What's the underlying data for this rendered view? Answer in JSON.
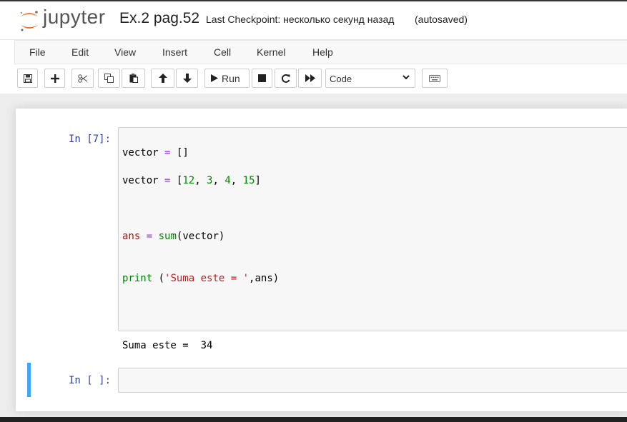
{
  "header": {
    "logo_text": "jupyter",
    "notebook_title": "Ex.2 pag.52",
    "checkpoint": "Last Checkpoint: несколько секунд назад",
    "autosave": "(autosaved)"
  },
  "menu": {
    "items": [
      "File",
      "Edit",
      "View",
      "Insert",
      "Cell",
      "Kernel",
      "Help"
    ]
  },
  "toolbar": {
    "run_label": "Run",
    "cell_type": "Code",
    "icons": [
      "save-icon",
      "plus-icon",
      "cut-icon",
      "copy-icon",
      "paste-icon",
      "arrow-up-icon",
      "arrow-down-icon",
      "run-icon",
      "stop-icon",
      "restart-icon",
      "fast-forward-icon",
      "keyboard-icon"
    ]
  },
  "cells": [
    {
      "prompt": "In [7]:",
      "lines": [
        [
          "vector",
          " ",
          "=",
          " ",
          "[]"
        ],
        [
          "vector",
          " ",
          "=",
          " ",
          "[",
          "12",
          ", ",
          "3",
          ", ",
          "4",
          ", ",
          "15",
          "]"
        ],
        [
          "ans",
          " ",
          "=",
          " ",
          "sum",
          "(vector)"
        ],
        [
          "print",
          " (",
          "'Suma este = '",
          ",ans)"
        ]
      ],
      "output": "Suma este =  34"
    },
    {
      "prompt": "In [ ]:"
    }
  ],
  "colors": {
    "prompt": "#303F9F",
    "selected_cell_border": "#42a5f5",
    "operator": "#aa22ff",
    "number": "#008800",
    "string": "#ba2121",
    "logo_orange": "#f37726"
  }
}
